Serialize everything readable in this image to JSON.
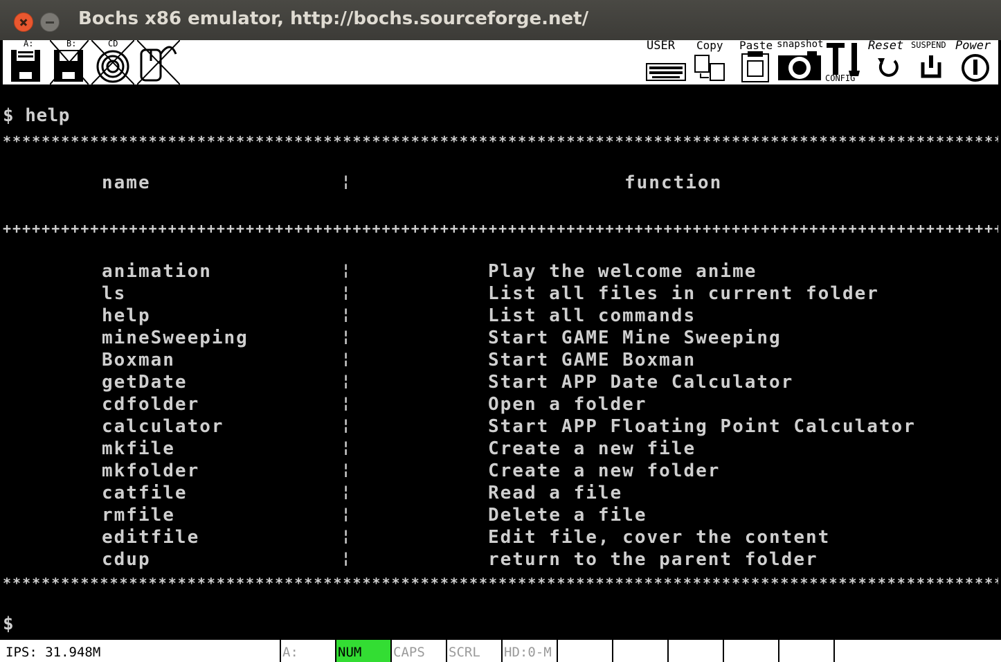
{
  "window": {
    "title": "Bochs x86 emulator, http://bochs.sourceforge.net/"
  },
  "toolbar": {
    "floppy_a_label": "A:",
    "floppy_b_label": "B:",
    "cdrom_label": "CD",
    "user_label": "USER",
    "copy_label": "Copy",
    "paste_label": "Paste",
    "snapshot_label": "snapshot",
    "config_label": "CONFIG",
    "reset_label": "Reset",
    "suspend_label": "SUSPEND",
    "power_label": "Power"
  },
  "terminal": {
    "command_line": "$ help",
    "stars_line": "****************************************************************************************************************",
    "plus_line": "++++++++++++++++++++++++++++++++++++++++++++++++++++++++++++++++++++++++++++++++++++++++++++++++++++++++++++++++",
    "header": {
      "name": "name",
      "separator": "¦",
      "function": "function"
    },
    "commands": [
      {
        "name": "animation",
        "function": "Play the welcome anime"
      },
      {
        "name": "ls",
        "function": "List all files in current folder"
      },
      {
        "name": "help",
        "function": "List all commands"
      },
      {
        "name": "mineSweeping",
        "function": "Start GAME Mine Sweeping"
      },
      {
        "name": "Boxman",
        "function": "Start GAME Boxman"
      },
      {
        "name": "getDate",
        "function": "Start APP Date Calculator"
      },
      {
        "name": "cdfolder",
        "function": "Open a folder"
      },
      {
        "name": "calculator",
        "function": "Start APP Floating Point Calculator"
      },
      {
        "name": "mkfile",
        "function": "Create a new file"
      },
      {
        "name": "mkfolder",
        "function": "Create a new folder"
      },
      {
        "name": "catfile",
        "function": "Read a file"
      },
      {
        "name": "rmfile",
        "function": "Delete a file"
      },
      {
        "name": "editfile",
        "function": "Edit file, cover the content"
      },
      {
        "name": "cdup",
        "function": "return to the parent folder"
      }
    ],
    "prompt": "$"
  },
  "statusbar": {
    "ips": "IPS: 31.948M",
    "drive": "A:",
    "num": "NUM",
    "caps": "CAPS",
    "scrl": "SCRL",
    "hd": "HD:0-M",
    "num_active_color": "#33dd33"
  }
}
